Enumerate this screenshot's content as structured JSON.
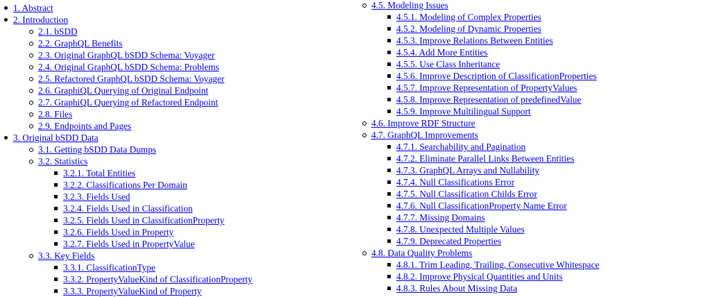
{
  "toc_left": [
    {
      "label": "1. Abstract"
    },
    {
      "label": "2. Introduction",
      "children": [
        {
          "label": "2.1. bSDD"
        },
        {
          "label": "2.2. GraphQL Benefits"
        },
        {
          "label": "2.3. Original GraphQL bSDD Schema: Voyager"
        },
        {
          "label": "2.4. Original GraphQL bSDD Schema: Problems"
        },
        {
          "label": "2.5. Refactored GraphQL bSDD Schema: Voyager"
        },
        {
          "label": "2.6. GraphiQL Querying of Original Endpoint"
        },
        {
          "label": "2.7. GraphiQL Querying of Refactored Endpoint"
        },
        {
          "label": "2.8. Files"
        },
        {
          "label": "2.9. Endpoints and Pages"
        }
      ]
    },
    {
      "label": "3. Original bSDD Data",
      "children": [
        {
          "label": "3.1. Getting bSDD Data Dumps"
        },
        {
          "label": "3.2. Statistics",
          "children": [
            {
              "label": "3.2.1. Total Entities"
            },
            {
              "label": "3.2.2. Classifications Per Domain"
            },
            {
              "label": "3.2.3. Fields Used"
            },
            {
              "label": "3.2.4. Fields Used in Classification"
            },
            {
              "label": "3.2.5. Fields Used in ClassificationProperty"
            },
            {
              "label": "3.2.6. Fields Used in Property"
            },
            {
              "label": "3.2.7. Fields Used in PropertyValue"
            }
          ]
        },
        {
          "label": "3.3. Key Fields",
          "children": [
            {
              "label": "3.3.1. ClassificationType"
            },
            {
              "label": "3.3.2. PropertyValueKind of ClassificationProperty"
            },
            {
              "label": "3.3.3. PropertyValueKind of Property"
            }
          ]
        }
      ]
    }
  ],
  "toc_right": [
    {
      "label": "4.5. Modeling Issues",
      "children": [
        {
          "label": "4.5.1. Modeling of Complex Properties"
        },
        {
          "label": "4.5.2. Modeling of Dynamic Properties"
        },
        {
          "label": "4.5.3. Improve Relations Between Entities"
        },
        {
          "label": "4.5.4. Add More Entities"
        },
        {
          "label": "4.5.5. Use Class Inheritance"
        },
        {
          "label": "4.5.6. Improve Description of ClassificationProperties"
        },
        {
          "label": "4.5.7. Improve Representation of PropertyValues"
        },
        {
          "label": "4.5.8. Improve Representation of predefinedValue"
        },
        {
          "label": "4.5.9. Improve Multilingual Support"
        }
      ]
    },
    {
      "label": "4.6. Improve RDF Structure"
    },
    {
      "label": "4.7. GraphQL Improvements",
      "children": [
        {
          "label": "4.7.1. Searchability and Pagination"
        },
        {
          "label": "4.7.2. Eliminate Parallel Links Between Entities"
        },
        {
          "label": "4.7.3. GraphQL Arrays and Nullability"
        },
        {
          "label": "4.7.4. Null Classifications Error"
        },
        {
          "label": "4.7.5. Null Classification Childs Error"
        },
        {
          "label": "4.7.6. Null ClassificationProperty Name Error"
        },
        {
          "label": "4.7.7. Missing Domains"
        },
        {
          "label": "4.7.8. Unexpected Multiple Values"
        },
        {
          "label": "4.7.9. Deprecated Properties"
        }
      ]
    },
    {
      "label": "4.8. Data Quality Problems",
      "children": [
        {
          "label": "4.8.1. Trim Leading, Trailing, Consecutive Whitespace"
        },
        {
          "label": "4.8.2. Improve Physical Quantities and Units"
        },
        {
          "label": "4.8.3. Rules About Missing Data"
        }
      ]
    }
  ]
}
